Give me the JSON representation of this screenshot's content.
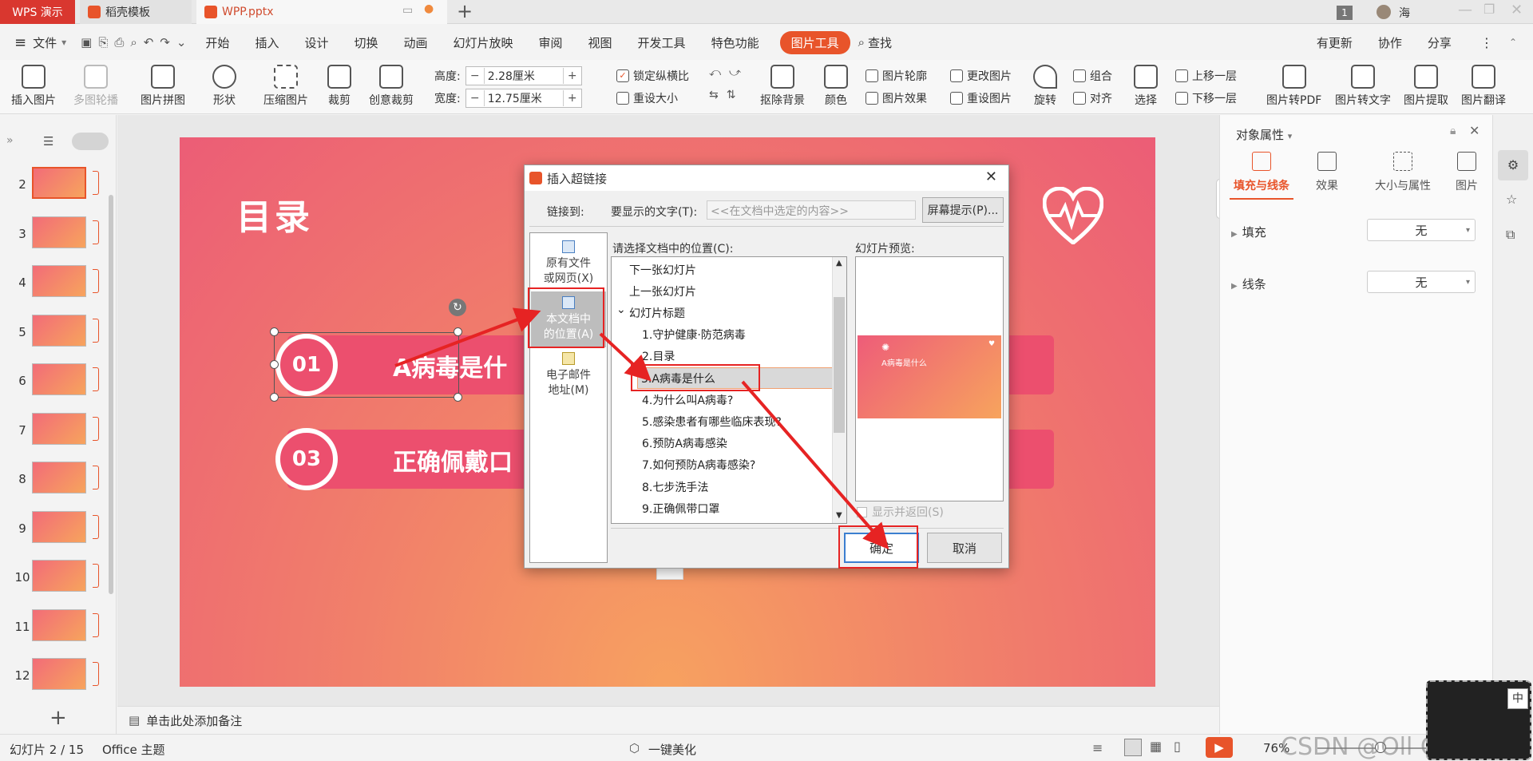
{
  "titlebar": {
    "app_tab": "WPS 演示",
    "tab2": "稻壳模板",
    "tab3": "WPP.pptx",
    "new_tab": "+",
    "page_badge": "1",
    "user_name": "海"
  },
  "menubar": {
    "file": "文件",
    "items": [
      "开始",
      "插入",
      "设计",
      "切换",
      "动画",
      "幻灯片放映",
      "审阅",
      "视图",
      "开发工具",
      "特色功能"
    ],
    "active_tab": "图片工具",
    "search": "查找",
    "right": [
      "有更新",
      "协作",
      "分享"
    ]
  },
  "ribbon": {
    "insert_pic": "插入图片",
    "multi_outline": "多图轮播",
    "pic_collage": "图片拼图",
    "shape": "形状",
    "compress": "压缩图片",
    "crop": "裁剪",
    "creative_crop": "创意裁剪",
    "height_label": "高度:",
    "height_value": "2.28厘米",
    "width_label": "宽度:",
    "width_value": "12.75厘米",
    "lock_ratio": "锁定纵横比",
    "reset_size": "重设大小",
    "remove_bg": "抠除背景",
    "color": "颜色",
    "pic_outline": "图片轮廓",
    "pic_effect": "图片效果",
    "change_pic": "更改图片",
    "reset_pic": "重设图片",
    "rotate": "旋转",
    "group": "组合",
    "align": "对齐",
    "select": "选择",
    "bring_forward": "上移一层",
    "send_backward": "下移一层",
    "to_pdf": "图片转PDF",
    "to_text": "图片转文字",
    "extract": "图片提取",
    "translate": "图片翻译"
  },
  "thumbnails": [
    "2",
    "3",
    "4",
    "5",
    "6",
    "7",
    "8",
    "9",
    "10",
    "11",
    "12"
  ],
  "add_slide": "+",
  "slide": {
    "title": "目录",
    "item1_num": "01",
    "item1_text": "A病毒是什",
    "item3_num": "03",
    "item3_text": "正确佩戴口"
  },
  "notes_placeholder": "单击此处添加备注",
  "right_panel": {
    "header": "对象属性",
    "tabs": [
      "填充与线条",
      "效果",
      "大小与属性",
      "图片"
    ],
    "fill_label": "填充",
    "fill_value": "无",
    "line_label": "线条",
    "line_value": "无"
  },
  "statusbar": {
    "slide_info": "幻灯片 2 / 15",
    "theme": "Office 主题",
    "beautify": "一键美化",
    "zoom": "76%",
    "watermark": "CSDN @Oll Correct"
  },
  "dialog": {
    "title": "插入超链接",
    "link_to_label": "链接到:",
    "display_text_label": "要显示的文字(T):",
    "display_text_value": "<<在文档中选定的内容>>",
    "screen_tip_button": "屏幕提示(P)...",
    "link_options": [
      {
        "line1": "原有文件",
        "line2": "或网页(X)"
      },
      {
        "line1": "本文档中",
        "line2": "的位置(A)"
      },
      {
        "line1": "电子邮件",
        "line2": "地址(M)"
      }
    ],
    "location_label": "请选择文档中的位置(C):",
    "location_items": [
      {
        "text": "下一张幻灯片",
        "level": 0
      },
      {
        "text": "上一张幻灯片",
        "level": 0
      },
      {
        "text": "幻灯片标题",
        "level": 0,
        "expanded": true
      },
      {
        "text": "1.守护健康·防范病毒",
        "level": 1
      },
      {
        "text": "2.目录",
        "level": 1
      },
      {
        "text": "3.A病毒是什么",
        "level": 1,
        "selected": true
      },
      {
        "text": "4.为什么叫A病毒?",
        "level": 1
      },
      {
        "text": "5.感染患者有哪些临床表现?",
        "level": 1
      },
      {
        "text": "6.预防A病毒感染",
        "level": 1
      },
      {
        "text": "7.如何预防A病毒感染?",
        "level": 1
      },
      {
        "text": "8.七步洗手法",
        "level": 1
      },
      {
        "text": "9.正确佩带口罩",
        "level": 1
      }
    ],
    "preview_label": "幻灯片预览:",
    "preview_slide_text": "A病毒是什么",
    "show_return": "显示并返回(S)",
    "ok_button": "确定",
    "cancel_button": "取消"
  },
  "colors": {
    "accent": "#e8542a",
    "annotation_red": "#e62323",
    "slide_pink": "#ec4f6e"
  }
}
